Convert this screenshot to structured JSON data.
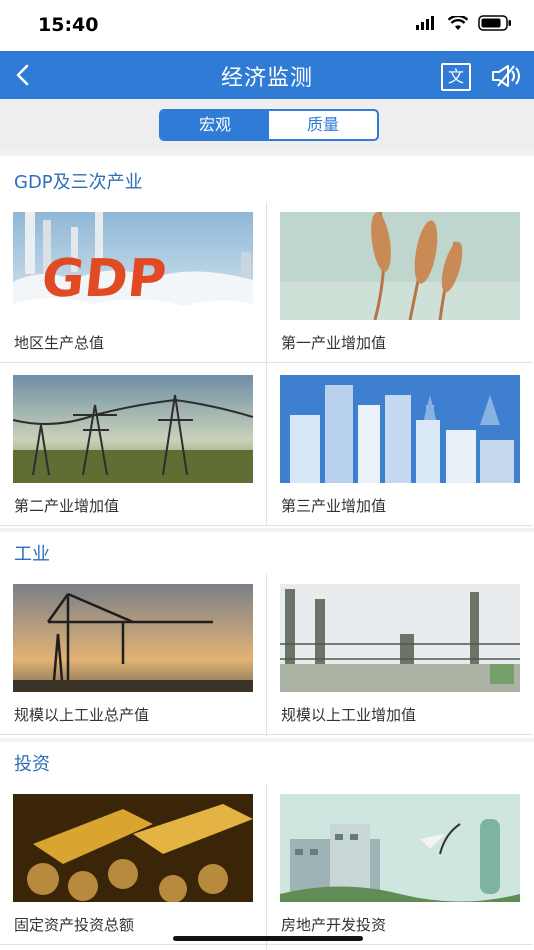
{
  "status": {
    "time": "15:40"
  },
  "nav": {
    "title": "经济监测",
    "lang_label": "文"
  },
  "tabs": {
    "macro": "宏观",
    "quality": "质量"
  },
  "sections": [
    {
      "title": "GDP及三次产业",
      "items": [
        {
          "label": "地区生产总值",
          "icon": "gdp-image"
        },
        {
          "label": "第一产业增加值",
          "icon": "wheat-image"
        },
        {
          "label": "第二产业增加值",
          "icon": "power-tower-image"
        },
        {
          "label": "第三产业增加值",
          "icon": "city-image"
        }
      ]
    },
    {
      "title": "工业",
      "items": [
        {
          "label": "规模以上工业总产值",
          "icon": "crane-image"
        },
        {
          "label": "规模以上工业增加值",
          "icon": "factory-image"
        }
      ]
    },
    {
      "title": "投资",
      "items": [
        {
          "label": "固定资产投资总额",
          "icon": "gold-image"
        },
        {
          "label": "房地产开发投资",
          "icon": "building-image"
        }
      ]
    }
  ],
  "colors": {
    "accent": "#2f7bd6",
    "section_title": "#2f6fb7"
  }
}
